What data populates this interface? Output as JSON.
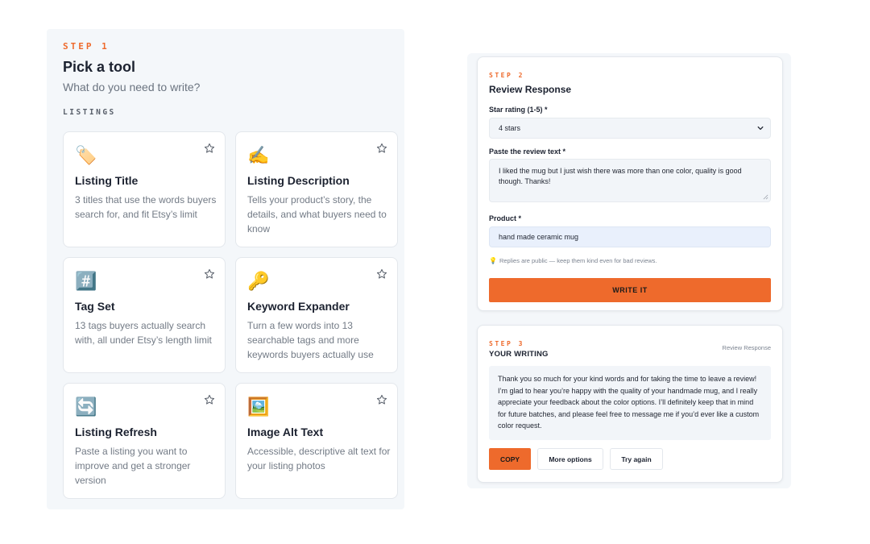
{
  "picker": {
    "step": "STEP 1",
    "title": "Pick a tool",
    "subtitle": "What do you need to write?",
    "section": "LISTINGS",
    "tools": [
      {
        "icon": "tag-icon",
        "glyph": "🏷️",
        "title": "Listing Title",
        "desc": "3 titles that use the words buyers search for, and fit Etsy’s limit"
      },
      {
        "icon": "writing-hand-icon",
        "glyph": "✍️",
        "title": "Listing Description",
        "desc": "Tells your product’s story, the details, and what buyers need to know"
      },
      {
        "icon": "hash-icon",
        "glyph": "#️⃣",
        "title": "Tag Set",
        "desc": "13 tags buyers actually search with, all under Etsy’s length limit"
      },
      {
        "icon": "key-icon",
        "glyph": "🔑",
        "title": "Keyword Expander",
        "desc": "Turn a few words into 13 searchable tags and more keywords buyers actually use"
      },
      {
        "icon": "refresh-icon",
        "glyph": "🔄",
        "title": "Listing Refresh",
        "desc": "Paste a listing you want to improve and get a stronger version"
      },
      {
        "icon": "framed-picture-icon",
        "glyph": "🖼️",
        "title": "Image Alt Text",
        "desc": "Accessible, descriptive alt text for your listing photos"
      }
    ]
  },
  "form": {
    "step": "STEP 2",
    "title": "Review Response",
    "rating_label": "Star rating (1-5) *",
    "rating_value": "4 stars",
    "review_label": "Paste the review text *",
    "review_value": "I liked the mug but I just wish there was more than one color, quality is good though. Thanks!",
    "product_label": "Product *",
    "product_value": "hand made ceramic mug",
    "hint": "Replies are public — keep them kind even for bad reviews.",
    "hint_icon": "lightbulb-icon",
    "submit_label": "WRITE IT"
  },
  "output": {
    "step": "STEP 3",
    "title": "YOUR WRITING",
    "tool_tag": "Review Response",
    "text": "Thank you so much for your kind words and for taking the time to leave a review! I’m glad to hear you’re happy with the quality of your handmade mug, and I really appreciate your feedback about the color options. I’ll definitely keep that in mind for future batches, and please feel free to message me if you’d ever like a custom color request.",
    "copy_label": "COPY",
    "more_label": "More options",
    "retry_label": "Try again"
  },
  "colors": {
    "accent": "#ee6a2c",
    "panel_bg": "#f4f7fa",
    "input_bg": "#f2f5f9",
    "focus_input_bg": "#e9f0fc"
  }
}
